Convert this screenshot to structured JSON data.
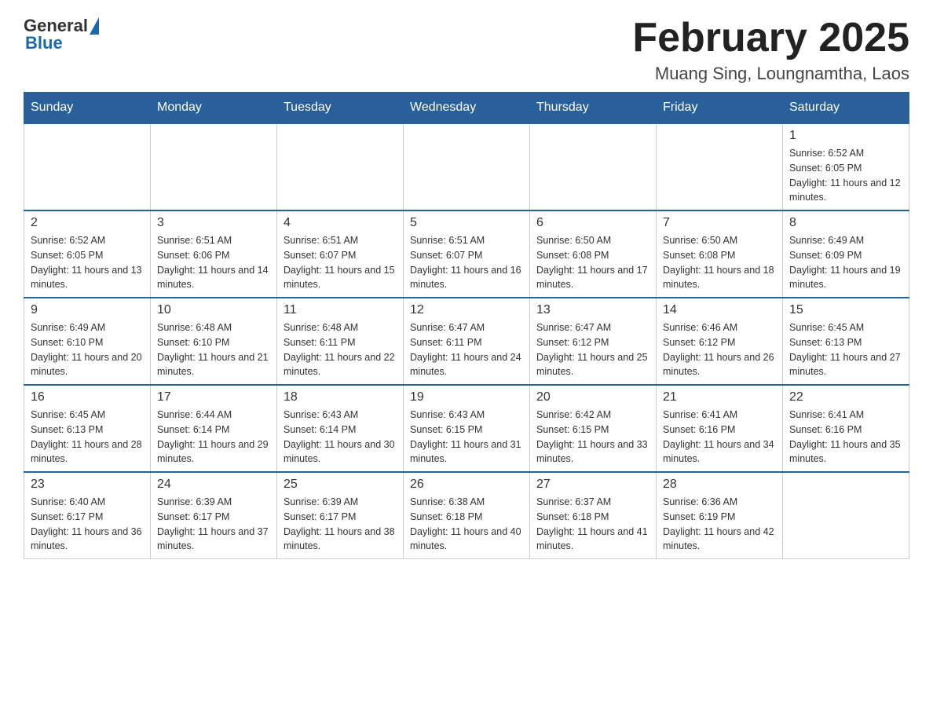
{
  "header": {
    "logo": {
      "general": "General",
      "blue": "Blue"
    },
    "title": "February 2025",
    "location": "Muang Sing, Loungnamtha, Laos"
  },
  "calendar": {
    "days_of_week": [
      "Sunday",
      "Monday",
      "Tuesday",
      "Wednesday",
      "Thursday",
      "Friday",
      "Saturday"
    ],
    "weeks": [
      [
        {
          "day": "",
          "info": ""
        },
        {
          "day": "",
          "info": ""
        },
        {
          "day": "",
          "info": ""
        },
        {
          "day": "",
          "info": ""
        },
        {
          "day": "",
          "info": ""
        },
        {
          "day": "",
          "info": ""
        },
        {
          "day": "1",
          "info": "Sunrise: 6:52 AM\nSunset: 6:05 PM\nDaylight: 11 hours and 12 minutes."
        }
      ],
      [
        {
          "day": "2",
          "info": "Sunrise: 6:52 AM\nSunset: 6:05 PM\nDaylight: 11 hours and 13 minutes."
        },
        {
          "day": "3",
          "info": "Sunrise: 6:51 AM\nSunset: 6:06 PM\nDaylight: 11 hours and 14 minutes."
        },
        {
          "day": "4",
          "info": "Sunrise: 6:51 AM\nSunset: 6:07 PM\nDaylight: 11 hours and 15 minutes."
        },
        {
          "day": "5",
          "info": "Sunrise: 6:51 AM\nSunset: 6:07 PM\nDaylight: 11 hours and 16 minutes."
        },
        {
          "day": "6",
          "info": "Sunrise: 6:50 AM\nSunset: 6:08 PM\nDaylight: 11 hours and 17 minutes."
        },
        {
          "day": "7",
          "info": "Sunrise: 6:50 AM\nSunset: 6:08 PM\nDaylight: 11 hours and 18 minutes."
        },
        {
          "day": "8",
          "info": "Sunrise: 6:49 AM\nSunset: 6:09 PM\nDaylight: 11 hours and 19 minutes."
        }
      ],
      [
        {
          "day": "9",
          "info": "Sunrise: 6:49 AM\nSunset: 6:10 PM\nDaylight: 11 hours and 20 minutes."
        },
        {
          "day": "10",
          "info": "Sunrise: 6:48 AM\nSunset: 6:10 PM\nDaylight: 11 hours and 21 minutes."
        },
        {
          "day": "11",
          "info": "Sunrise: 6:48 AM\nSunset: 6:11 PM\nDaylight: 11 hours and 22 minutes."
        },
        {
          "day": "12",
          "info": "Sunrise: 6:47 AM\nSunset: 6:11 PM\nDaylight: 11 hours and 24 minutes."
        },
        {
          "day": "13",
          "info": "Sunrise: 6:47 AM\nSunset: 6:12 PM\nDaylight: 11 hours and 25 minutes."
        },
        {
          "day": "14",
          "info": "Sunrise: 6:46 AM\nSunset: 6:12 PM\nDaylight: 11 hours and 26 minutes."
        },
        {
          "day": "15",
          "info": "Sunrise: 6:45 AM\nSunset: 6:13 PM\nDaylight: 11 hours and 27 minutes."
        }
      ],
      [
        {
          "day": "16",
          "info": "Sunrise: 6:45 AM\nSunset: 6:13 PM\nDaylight: 11 hours and 28 minutes."
        },
        {
          "day": "17",
          "info": "Sunrise: 6:44 AM\nSunset: 6:14 PM\nDaylight: 11 hours and 29 minutes."
        },
        {
          "day": "18",
          "info": "Sunrise: 6:43 AM\nSunset: 6:14 PM\nDaylight: 11 hours and 30 minutes."
        },
        {
          "day": "19",
          "info": "Sunrise: 6:43 AM\nSunset: 6:15 PM\nDaylight: 11 hours and 31 minutes."
        },
        {
          "day": "20",
          "info": "Sunrise: 6:42 AM\nSunset: 6:15 PM\nDaylight: 11 hours and 33 minutes."
        },
        {
          "day": "21",
          "info": "Sunrise: 6:41 AM\nSunset: 6:16 PM\nDaylight: 11 hours and 34 minutes."
        },
        {
          "day": "22",
          "info": "Sunrise: 6:41 AM\nSunset: 6:16 PM\nDaylight: 11 hours and 35 minutes."
        }
      ],
      [
        {
          "day": "23",
          "info": "Sunrise: 6:40 AM\nSunset: 6:17 PM\nDaylight: 11 hours and 36 minutes."
        },
        {
          "day": "24",
          "info": "Sunrise: 6:39 AM\nSunset: 6:17 PM\nDaylight: 11 hours and 37 minutes."
        },
        {
          "day": "25",
          "info": "Sunrise: 6:39 AM\nSunset: 6:17 PM\nDaylight: 11 hours and 38 minutes."
        },
        {
          "day": "26",
          "info": "Sunrise: 6:38 AM\nSunset: 6:18 PM\nDaylight: 11 hours and 40 minutes."
        },
        {
          "day": "27",
          "info": "Sunrise: 6:37 AM\nSunset: 6:18 PM\nDaylight: 11 hours and 41 minutes."
        },
        {
          "day": "28",
          "info": "Sunrise: 6:36 AM\nSunset: 6:19 PM\nDaylight: 11 hours and 42 minutes."
        },
        {
          "day": "",
          "info": ""
        }
      ]
    ]
  }
}
